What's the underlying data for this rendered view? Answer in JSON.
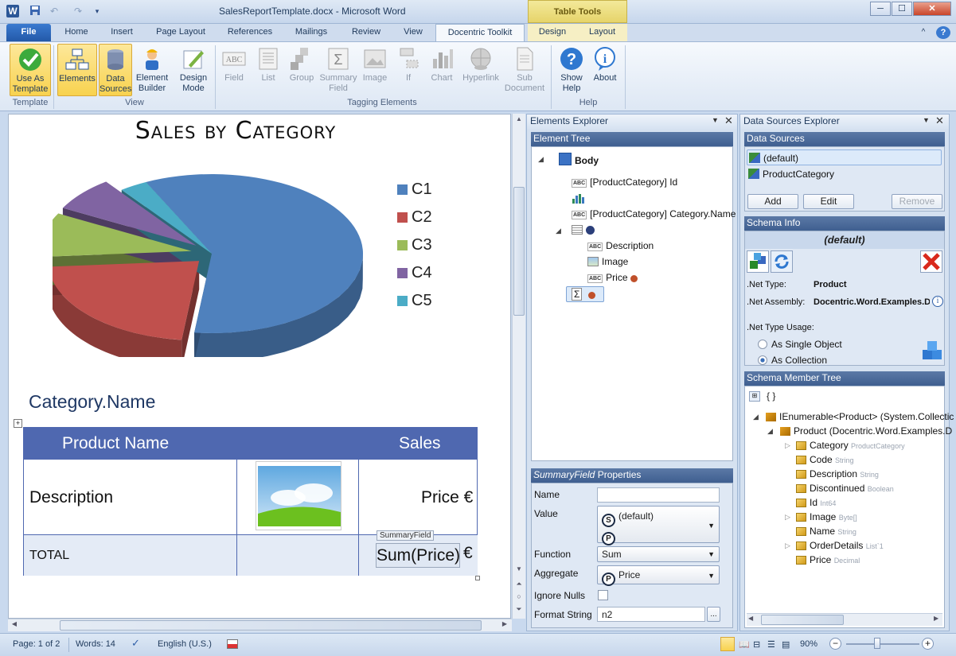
{
  "window": {
    "title": "SalesReportTemplate.docx - Microsoft Word",
    "context_tab": "Table Tools",
    "btn_min": "─",
    "btn_max": "☐",
    "btn_close": "✕"
  },
  "quick_access": {
    "word_icon": "W",
    "save_icon": "save-icon",
    "undo_icon": "undo-icon",
    "redo_icon": "redo-icon"
  },
  "tabs": [
    "File",
    "Home",
    "Insert",
    "Page Layout",
    "References",
    "Mailings",
    "Review",
    "View",
    "Docentric Toolkit",
    "Design",
    "Layout"
  ],
  "ribbon": {
    "template_group": "Template",
    "view_group": "View",
    "tagging_group": "Tagging Elements",
    "help_group": "Help",
    "use_as_template": [
      "Use As",
      "Template"
    ],
    "elements": "Elements",
    "data_sources": [
      "Data",
      "Sources"
    ],
    "element_builder": [
      "Element",
      "Builder"
    ],
    "design_mode": [
      "Design",
      "Mode"
    ],
    "field": "Field",
    "list": "List",
    "group": "Group",
    "summary_field": [
      "Summary",
      "Field"
    ],
    "image": "Image",
    "if": "If",
    "chart": "Chart",
    "hyperlink": "Hyperlink",
    "sub_document": [
      "Sub",
      "Document"
    ],
    "show_help": [
      "Show",
      "Help"
    ],
    "about": "About"
  },
  "document": {
    "chart_title": "Sales by Category",
    "legend": [
      "C1",
      "C2",
      "C3",
      "C4",
      "C5"
    ],
    "legend_colors": [
      "#4f81bd",
      "#c0504d",
      "#9bbb59",
      "#8064a2",
      "#4bacc6"
    ],
    "category_name": "Category.Name",
    "table": {
      "header_product": "Product Name",
      "header_sales": "Sales",
      "row_description": "Description",
      "row_price": "Price €",
      "total_label": "TOTAL",
      "sum_tag": "SummaryField",
      "sum_value": "Sum(Price)",
      "euro": "€"
    }
  },
  "chart_data": {
    "type": "pie",
    "title": "Sales by Category",
    "categories": [
      "C1",
      "C2",
      "C3",
      "C4",
      "C5"
    ],
    "values": [
      59,
      22,
      9,
      7,
      3
    ],
    "legend": "right"
  },
  "elements_explorer": {
    "title": "Elements Explorer",
    "tree_header": "Element Tree",
    "body": "Body",
    "node_id": "[ProductCategory] Id",
    "node_category_name": "[ProductCategory] Category.Name",
    "node_description": "Description",
    "node_image": "Image",
    "node_price": "Price",
    "props_title_italic": "SummaryField",
    "props_title": " Properties",
    "lbl_name": "Name",
    "lbl_value": "Value",
    "value_source": "(default)",
    "lbl_function": "Function",
    "function": "Sum",
    "lbl_aggregate": "Aggregate",
    "aggregate": "Price",
    "lbl_ignore_nulls": "Ignore Nulls",
    "lbl_format_string": "Format String",
    "format_string": "n2",
    "ellipsis": "..."
  },
  "data_sources_explorer": {
    "title": "Data Sources Explorer",
    "ds_header": "Data Sources",
    "ds_items": [
      "(default)",
      "ProductCategory"
    ],
    "btn_add": "Add",
    "btn_edit": "Edit",
    "btn_remove": "Remove",
    "schema_header": "Schema Info",
    "schema_name": "(default)",
    "net_type_label": ".Net Type:",
    "net_type": "Product",
    "net_assembly_label": ".Net Assembly:",
    "net_assembly": "Docentric.Word.Examples.Da",
    "usage_label": ".Net Type Usage:",
    "usage_single": "As Single Object",
    "usage_collection": "As Collection",
    "member_tree_header": "Schema Member Tree",
    "root": "IEnumerable<Product> (System.Collectic",
    "product": "Product (Docentric.Word.Examples.D",
    "members": [
      {
        "name": "Category",
        "type": "ProductCategory"
      },
      {
        "name": "Code",
        "type": "String"
      },
      {
        "name": "Description",
        "type": "String"
      },
      {
        "name": "Discontinued",
        "type": "Boolean"
      },
      {
        "name": "Id",
        "type": "Int64"
      },
      {
        "name": "Image",
        "type": "Byte[]"
      },
      {
        "name": "Name",
        "type": "String"
      },
      {
        "name": "OrderDetails",
        "type": "List`1"
      },
      {
        "name": "Price",
        "type": "Decimal"
      }
    ],
    "braces": "{ }"
  },
  "status": {
    "page": "Page: 1 of 2",
    "words": "Words: 14",
    "language": "English (U.S.)",
    "zoom": "90%"
  }
}
